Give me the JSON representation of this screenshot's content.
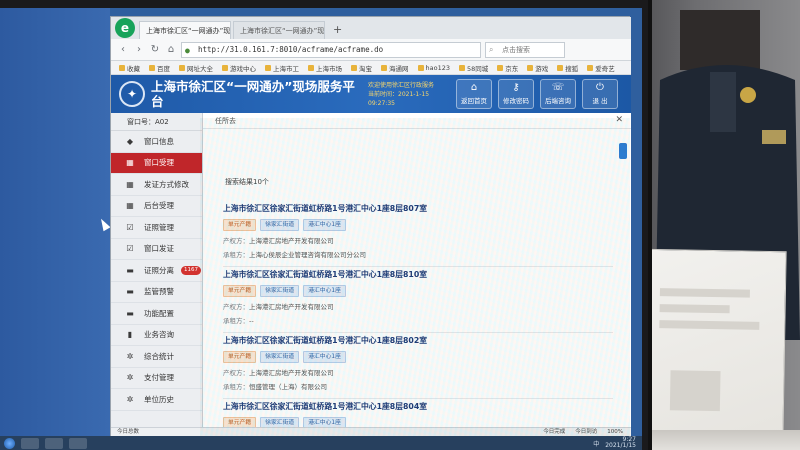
{
  "browser": {
    "tabs": [
      {
        "label": "上海市徐汇区“一网通办”现场"
      },
      {
        "label": "上海市徐汇区“一网通办”现场"
      }
    ],
    "url": "http://31.0.161.7:8010/acframe/acframe.do",
    "search_placeholder": "点击搜索",
    "favorites": [
      "收藏",
      "百度",
      "网址大全",
      "游戏中心",
      "上海市工",
      "上海市场",
      "淘宝",
      "海通网",
      "hao123",
      "58同城",
      "京东",
      "游戏",
      "搜狐",
      "爱奇艺"
    ]
  },
  "app": {
    "title": "上海市徐汇区“一网通办”现场服务平台",
    "header_info": [
      "欢迎使用徐汇区行政服务",
      "当前时间：2021-1-15 09:27:35"
    ],
    "header_buttons": [
      {
        "label": "返回首页",
        "icon": "home-icon",
        "glyph": "⌂"
      },
      {
        "label": "修改密码",
        "icon": "key-icon",
        "glyph": "⚷"
      },
      {
        "label": "后端咨询",
        "icon": "chat-icon",
        "glyph": "☏"
      },
      {
        "label": "退 出",
        "icon": "exit-icon",
        "glyph": "⏻"
      }
    ],
    "window_no": "窗口号：A02",
    "sidebar": [
      {
        "label": "窗口信息",
        "icon": "tag-icon",
        "glyph": "◆"
      },
      {
        "label": "窗口受理",
        "icon": "grid-icon",
        "glyph": "▦",
        "active": true
      },
      {
        "label": "发证方式修改",
        "icon": "grid-icon",
        "glyph": "▦"
      },
      {
        "label": "后台受理",
        "icon": "grid-icon",
        "glyph": "▦"
      },
      {
        "label": "证照管理",
        "icon": "check-icon",
        "glyph": "☑"
      },
      {
        "label": "窗口发证",
        "icon": "check-icon",
        "glyph": "☑"
      },
      {
        "label": "证照分离",
        "icon": "comment-icon",
        "glyph": "▬",
        "badge": "1167"
      },
      {
        "label": "监管预警",
        "icon": "comment-icon",
        "glyph": "▬"
      },
      {
        "label": "功能配置",
        "icon": "comment-icon",
        "glyph": "▬"
      },
      {
        "label": "业务咨询",
        "icon": "file-icon",
        "glyph": "▮"
      },
      {
        "label": "综合统计",
        "icon": "gear-icon",
        "glyph": "✲"
      },
      {
        "label": "支付管理",
        "icon": "gear-icon",
        "glyph": "✲"
      },
      {
        "label": "单位历史",
        "icon": "gear-icon",
        "glyph": "✲"
      }
    ],
    "breadcrumb": "任所去",
    "result_count": "搜索结果10个",
    "results": [
      {
        "title": "上海市徐汇区徐家汇街道虹桥路1号港汇中心1座8层807室",
        "tags": [
          "单元产籍",
          "徐家汇街道",
          "港汇中心1座"
        ],
        "owner_label": "产权方：",
        "owner": "上海港汇房地产开发有限公司",
        "tenant_label": "承租方：",
        "tenant": "上海心侯辰企业管理咨询有限公司分公司"
      },
      {
        "title": "上海市徐汇区徐家汇街道虹桥路1号港汇中心1座8层810室",
        "tags": [
          "单元产籍",
          "徐家汇街道",
          "港汇中心1座"
        ],
        "owner_label": "产权方：",
        "owner": "上海港汇房地产开发有限公司",
        "tenant_label": "承租方：",
        "tenant": "--"
      },
      {
        "title": "上海市徐汇区徐家汇街道虹桥路1号港汇中心1座8层802室",
        "tags": [
          "单元产籍",
          "徐家汇街道",
          "港汇中心1座"
        ],
        "owner_label": "产权方：",
        "owner": "上海港汇房地产开发有限公司",
        "tenant_label": "承租方：",
        "tenant": "恒盛管理（上海）有限公司"
      },
      {
        "title": "上海市徐汇区徐家汇街道虹桥路1号港汇中心1座8层804室",
        "tags": [
          "单元产籍",
          "徐家汇街道",
          "港汇中心1座"
        ],
        "owner_label": "产权方：",
        "owner": "上海港汇房地产开发有限公司",
        "tenant_label": "",
        "tenant": ""
      }
    ],
    "status_left": "今日总数",
    "status_right": [
      "今日完成",
      "今日到访",
      "100%"
    ]
  },
  "taskbar": {
    "clock_time": "9:27",
    "clock_date": "2021/1/15",
    "ime": "中"
  }
}
